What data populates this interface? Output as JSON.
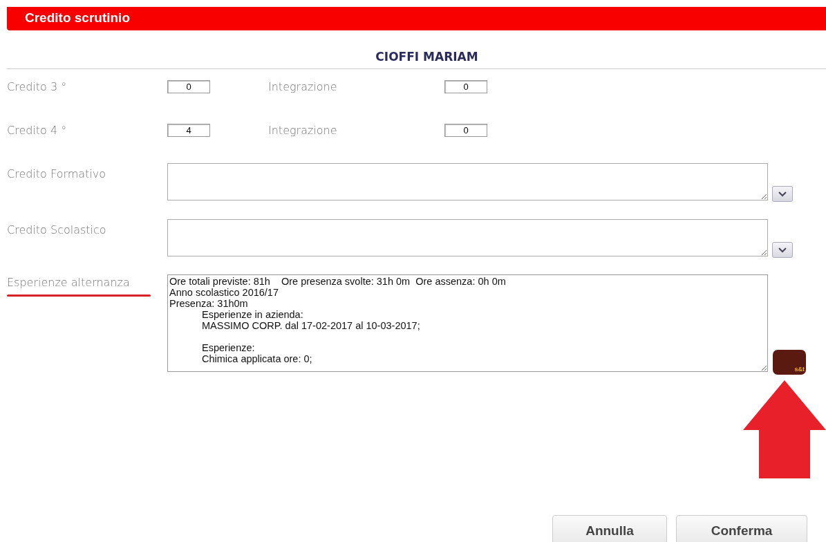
{
  "header": {
    "title": "Credito scrutinio"
  },
  "student": {
    "name": "CIOFFI MARIAM"
  },
  "credit_rows": [
    {
      "label": "Credito 3 °",
      "value": "0",
      "integration_label": "Integrazione",
      "integration_value": "0"
    },
    {
      "label": "Credito 4 °",
      "value": "4",
      "integration_label": "Integrazione",
      "integration_value": "0"
    }
  ],
  "text_fields": [
    {
      "label": "Credito Formativo",
      "kind": "dropdown"
    },
    {
      "label": "Credito Scolastico",
      "kind": "dropdown"
    }
  ],
  "experience": {
    "label": "Esperienze alternanza",
    "underlined": true,
    "button_text": "s&t",
    "lines": [
      {
        "text": "Ore totali previste: 81h    Ore presenza svolte: 31h 0m  Ore assenza: 0h 0m"
      },
      {
        "text": "Anno scolastico 2016/17"
      },
      {
        "text": "Presenza: 31h0m",
        "children": [
          {
            "lines": [
              "Esperienze in azienda:",
              "MASSIMO CORP. dal 17-02-2017 al 10-03-2017;"
            ]
          },
          {
            "lines": [
              "Esperienze:",
              "Chimica applicata ore: 0;"
            ]
          }
        ]
      }
    ]
  },
  "annotation": {
    "arrow": true
  },
  "buttons": [
    {
      "label": "Annulla"
    },
    {
      "label": "Conferma"
    }
  ]
}
